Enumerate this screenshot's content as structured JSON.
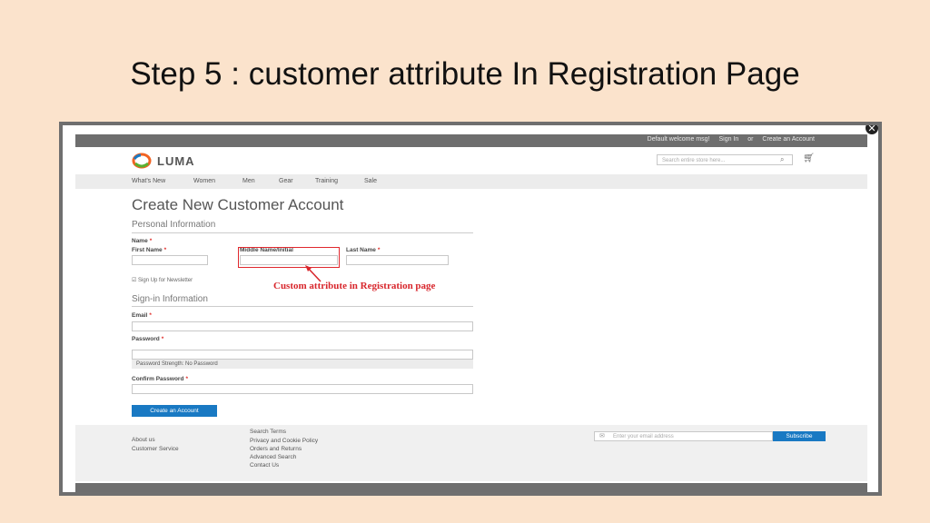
{
  "slide": {
    "title": "Step 5 : customer attribute In Registration Page"
  },
  "header": {
    "welcome": "Default welcome msg!",
    "sign_in": "Sign In",
    "or": "or",
    "create_account": "Create an Account",
    "close_icon": "close-icon"
  },
  "brand": {
    "logo_text": "LUMA",
    "logo_colors": [
      "#f26322",
      "#5ab031",
      "#1979c3"
    ]
  },
  "search": {
    "placeholder": "Search entire store here..."
  },
  "nav": {
    "items": [
      {
        "label": "What's New"
      },
      {
        "label": "Women"
      },
      {
        "label": "Men"
      },
      {
        "label": "Gear"
      },
      {
        "label": "Training"
      },
      {
        "label": "Sale"
      }
    ]
  },
  "form": {
    "heading": "Create New Customer Account",
    "personal_info": "Personal Information",
    "name_label": "Name",
    "first_name_label": "First Name",
    "middle_name_label": "Middle Name/Initial",
    "last_name_label": "Last Name",
    "newsletter_label": "Sign Up for Newsletter",
    "sign_in_info": "Sign-in Information",
    "email_label": "Email",
    "password_label": "Password",
    "password_strength": "Password Strength: No Password",
    "confirm_password_label": "Confirm Password",
    "required_marker": "*",
    "create_button": "Create an Account"
  },
  "annotation": {
    "callout": "Custom attribute in Registration page",
    "color": "#d8262c"
  },
  "footer": {
    "col1": [
      "About us",
      "Customer Service"
    ],
    "col2": [
      "Search Terms",
      "Privacy and Cookie Policy",
      "Orders and Returns",
      "Advanced Search",
      "Contact Us"
    ],
    "newsletter_placeholder": "Enter your email address",
    "subscribe_button": "Subscribe"
  },
  "colors": {
    "slide_bg": "#fbe3cc",
    "accent_blue": "#1979c3"
  }
}
